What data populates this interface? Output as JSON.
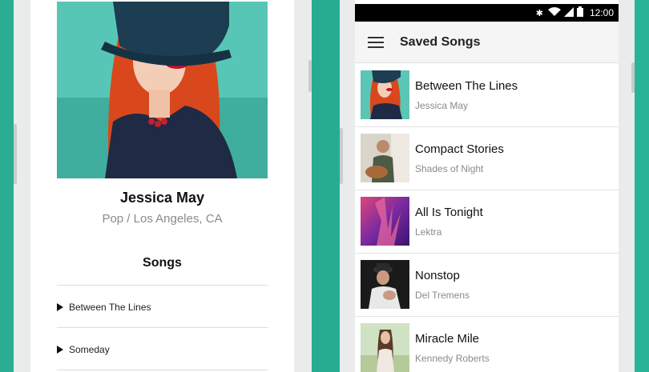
{
  "left_screen": {
    "artist": {
      "name": "Jessica May",
      "meta": "Pop / Los Angeles, CA"
    },
    "songs_heading": "Songs",
    "songs": [
      {
        "label": "Between The Lines"
      },
      {
        "label": "Someday"
      }
    ]
  },
  "right_screen": {
    "status_bar": {
      "time": "12:00",
      "icons": [
        "bluetooth-icon",
        "wifi-icon",
        "signal-icon",
        "battery-icon"
      ]
    },
    "app_bar": {
      "title": "Saved Songs",
      "menu_icon": "menu-icon"
    },
    "saved_songs": [
      {
        "title": "Between The Lines",
        "artist": "Jessica May"
      },
      {
        "title": "Compact Stories",
        "artist": "Shades of Night"
      },
      {
        "title": "All Is Tonight",
        "artist": "Lektra"
      },
      {
        "title": "Nonstop",
        "artist": "Del Tremens"
      },
      {
        "title": "Miracle Mile",
        "artist": "Kennedy Roberts"
      }
    ]
  },
  "colors": {
    "background_teal": "#2fb59c",
    "text_primary": "#111111",
    "text_secondary": "#8a8a8a",
    "status_bar": "#000000"
  }
}
